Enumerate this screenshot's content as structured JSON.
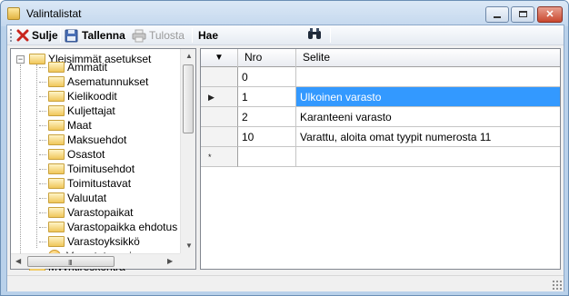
{
  "window": {
    "title": "Valintalistat",
    "controls": {
      "minimize": "minimize",
      "maximize": "maximize",
      "close": "✕"
    }
  },
  "toolbar": {
    "close_label": "Sulje",
    "save_label": "Tallenna",
    "print_label": "Tulosta",
    "search_label": "Hae"
  },
  "tree": {
    "root_label": "Yleisimmät asetukset",
    "items": [
      {
        "label": "Ammatit"
      },
      {
        "label": "Asematunnukset"
      },
      {
        "label": "Kielikoodit"
      },
      {
        "label": "Kuljettajat"
      },
      {
        "label": "Maat"
      },
      {
        "label": "Maksuehdot"
      },
      {
        "label": "Osastot"
      },
      {
        "label": "Toimitusehdot"
      },
      {
        "label": "Toimitustavat"
      },
      {
        "label": "Valuutat"
      },
      {
        "label": "Varastopaikat"
      },
      {
        "label": "Varastopaikka ehdotus"
      },
      {
        "label": "Varastoyksikkö"
      },
      {
        "label": "Varastotyyppi"
      }
    ],
    "next_root_label": "Myyntireskontra",
    "scroll_grip": "III"
  },
  "grid": {
    "header_icon": "▼",
    "columns": [
      "Nro",
      "Selite"
    ],
    "rows": [
      {
        "marker": "",
        "nro": "0",
        "selite": ""
      },
      {
        "marker": "▶",
        "nro": "1",
        "selite": "Ulkoinen varasto"
      },
      {
        "marker": "",
        "nro": "2",
        "selite": "Karanteeni varasto"
      },
      {
        "marker": "",
        "nro": "10",
        "selite": "Varattu, aloita omat tyypit numerosta 11"
      },
      {
        "marker": "*",
        "nro": "",
        "selite": ""
      }
    ],
    "selected_row_index": 1
  },
  "colors": {
    "selection": "#3399ff",
    "title_bar": "#c4d8ee",
    "close_button": "#c9482f"
  }
}
